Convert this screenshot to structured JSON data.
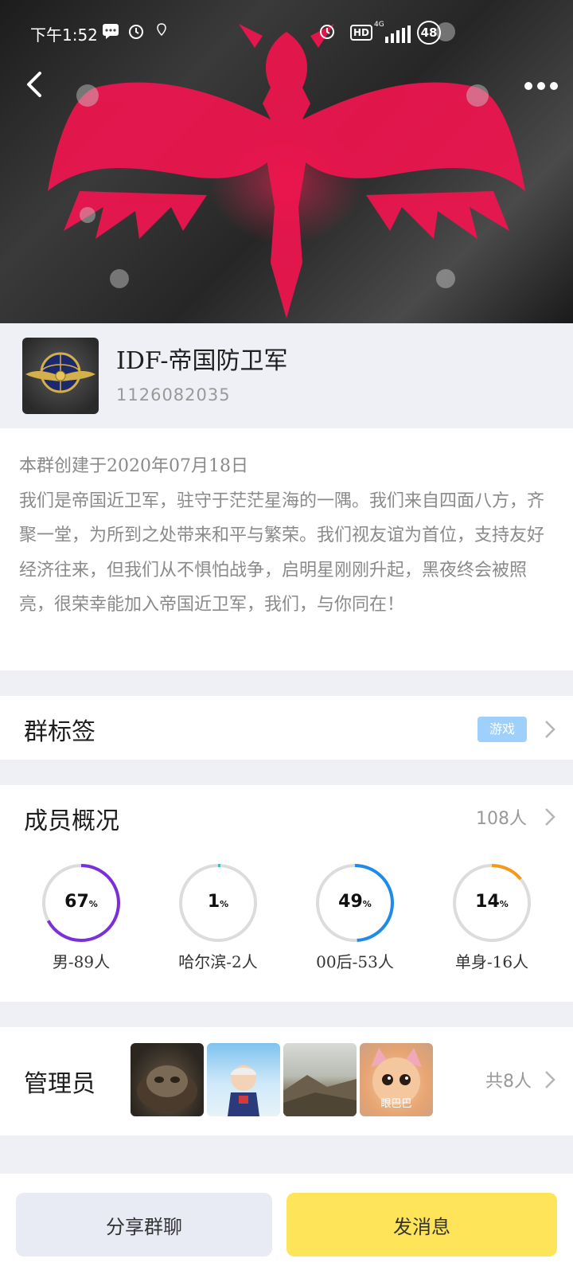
{
  "status_bar": {
    "time": "下午1:52",
    "network_label": "HD",
    "signal_label": "4G",
    "battery": "48"
  },
  "group": {
    "name": "IDF-帝国防卫军",
    "id": "1126082035"
  },
  "intro": {
    "text": "本群创建于2020年07月18日\n我们是帝国近卫军，驻守于茫茫星海的一隅。我们来自四面八方，齐聚一堂，为所到之处带来和平与繁荣。我们视友谊为首位，支持友好经济往来，但我们从不惧怕战争，启明星刚刚升起，黑夜终会被照亮，很荣幸能加入帝国近卫军，我们，与你同在！"
  },
  "tags": {
    "title": "群标签",
    "badge": "游戏"
  },
  "members": {
    "title": "成员概况",
    "count": "108人",
    "stats": [
      {
        "value": 67,
        "pct_text": "67",
        "unit": "%",
        "label": "男-89人",
        "color": "#7b2fd6"
      },
      {
        "value": 1,
        "pct_text": "1",
        "unit": "%",
        "label": "哈尔滨-2人",
        "color": "#2cc7b4"
      },
      {
        "value": 49,
        "pct_text": "49",
        "unit": "%",
        "label": "00后-53人",
        "color": "#1e8be8"
      },
      {
        "value": 14,
        "pct_text": "14",
        "unit": "%",
        "label": "单身-16人",
        "color": "#f39a1c"
      }
    ]
  },
  "admins": {
    "title": "管理员",
    "avatar4_text": "眼巴巴",
    "total": "共8人"
  },
  "actions": {
    "share_label": "分享群聊",
    "send_label": "发消息"
  },
  "colors": {
    "tag_badge": "#9ed0fb",
    "send_button": "#fde458",
    "share_button": "#e8ebf3"
  }
}
